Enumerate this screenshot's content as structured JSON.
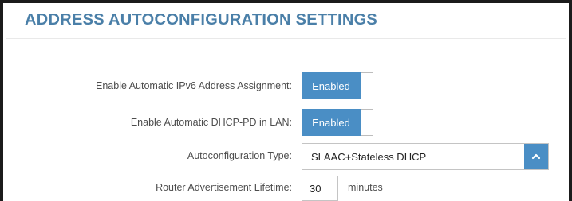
{
  "section": {
    "title": "ADDRESS AUTOCONFIGURATION SETTINGS"
  },
  "fields": {
    "ipv6_assignment": {
      "label": "Enable Automatic IPv6 Address Assignment:",
      "value": "Enabled"
    },
    "dhcp_pd": {
      "label": "Enable Automatic DHCP-PD in LAN:",
      "value": "Enabled"
    },
    "autoconfig_type": {
      "label": "Autoconfiguration Type:",
      "value": "SLAAC+Stateless DHCP",
      "caret_icon": "chevron-up-icon"
    },
    "ra_lifetime": {
      "label": "Router Advertisement Lifetime:",
      "value": "30",
      "unit": "minutes"
    }
  },
  "colors": {
    "title": "#4a7fa8",
    "accent": "#4a8ec5",
    "label": "#4d4d4d"
  }
}
